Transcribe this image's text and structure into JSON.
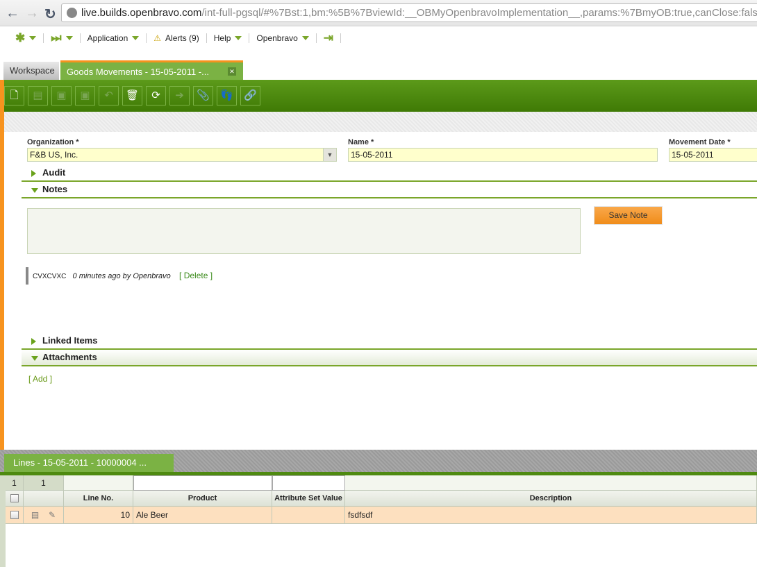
{
  "browser": {
    "url_host": "live.builds.openbravo.com",
    "url_path": "/int-full-pgsql/#%7Bst:1,bm:%5B%7BviewId:__OBMyOpenbravoImplementation__,params:%7BmyOB:true,canClose:false,ta"
  },
  "menu": {
    "application": "Application",
    "alerts": "Alerts (9)",
    "help": "Help",
    "user": "Openbravo"
  },
  "tabs": {
    "workspace": "Workspace",
    "goods": "Goods Movements - 15-05-2011 -..."
  },
  "form": {
    "organization_label": "Organization *",
    "organization_value": "F&B US, Inc.",
    "name_label": "Name *",
    "name_value": "15-05-2011",
    "date_label": "Movement Date *",
    "date_value": "15-05-2011"
  },
  "sections": {
    "audit": "Audit",
    "notes": "Notes",
    "linked": "Linked Items",
    "attachments": "Attachments"
  },
  "notes": {
    "save": "Save Note",
    "note_text": "cvxcvxc",
    "note_meta": "0 minutes ago by Openbravo",
    "delete": "[ Delete ]"
  },
  "attachments": {
    "add": "[ Add ]"
  },
  "lines": {
    "tab": "Lines - 15-05-2011 - 10000004 ...",
    "summary": [
      "1",
      "1"
    ],
    "headers": [
      "Line No.",
      "Product",
      "Attribute Set Value",
      "Description"
    ],
    "rows": [
      {
        "line": "10",
        "product": "Ale Beer",
        "attr": "",
        "desc": "fsdfsdf"
      }
    ]
  }
}
